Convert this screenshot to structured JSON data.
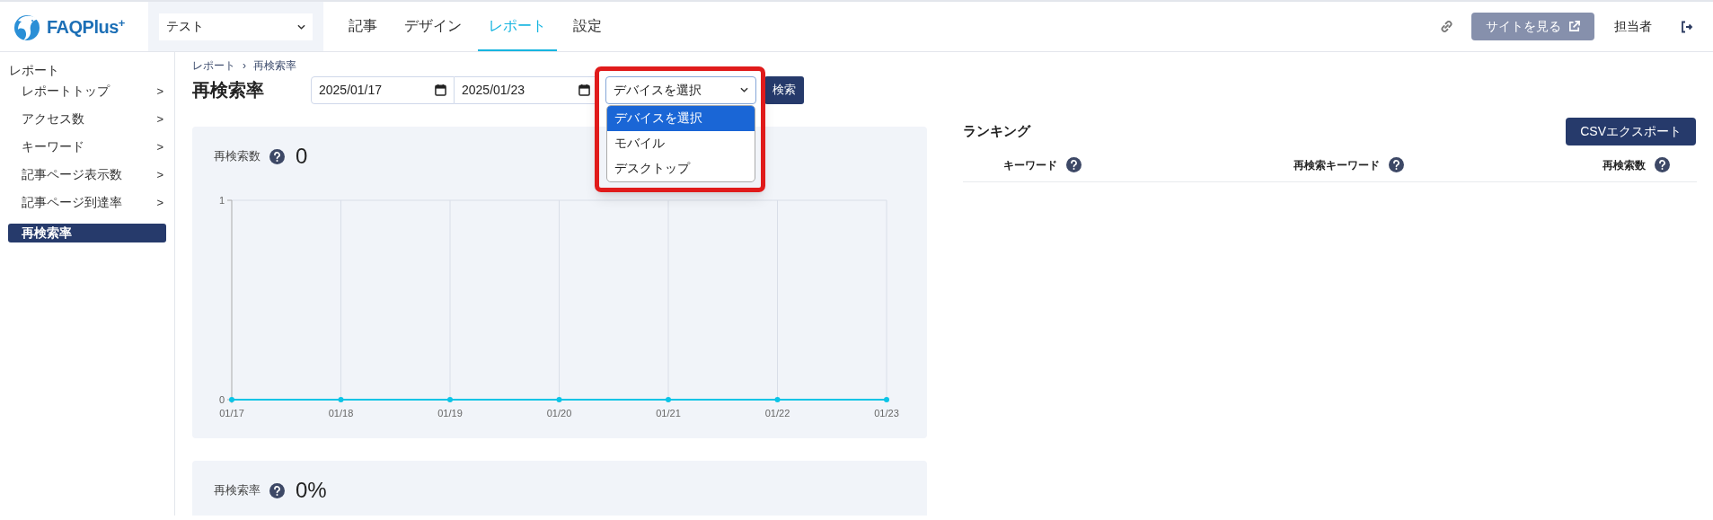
{
  "header": {
    "logo_text": "FAQPlus",
    "logo_sup": "+",
    "site_select": {
      "value": "テスト"
    },
    "nav": [
      {
        "label": "記事",
        "selected": false
      },
      {
        "label": "デザイン",
        "selected": false
      },
      {
        "label": "レポート",
        "selected": true
      },
      {
        "label": "設定",
        "selected": false
      }
    ],
    "view_site_button": "サイトを見る",
    "user": "担当者"
  },
  "sidebar": {
    "section": "レポート",
    "items": [
      {
        "label": "レポートトップ",
        "chevron": ">",
        "selected": false
      },
      {
        "label": "アクセス数",
        "chevron": ">",
        "selected": false
      },
      {
        "label": "キーワード",
        "chevron": ">",
        "selected": false
      },
      {
        "label": "記事ページ表示数",
        "chevron": ">",
        "selected": false
      },
      {
        "label": "記事ページ到達率",
        "chevron": ">",
        "selected": false
      },
      {
        "label": "再検索率",
        "selected": true
      }
    ]
  },
  "breadcrumb": [
    "レポート",
    "›",
    "再検索率"
  ],
  "title": "再検索率",
  "filters": {
    "start_date": "2025/01/17",
    "end_date": "2025/01/23",
    "device_select": {
      "value": "デバイスを選択",
      "expanded": true,
      "highlighted": true,
      "options": [
        {
          "label": "デバイスを選択",
          "selected": true
        },
        {
          "label": "モバイル",
          "selected": false
        },
        {
          "label": "デスクトップ",
          "selected": false
        }
      ]
    },
    "search_button": "検索"
  },
  "cards": [
    {
      "label": "再検索数",
      "value": "0",
      "chart_data": {
        "type": "line",
        "x": [
          "01/17",
          "01/18",
          "01/19",
          "01/20",
          "01/21",
          "01/22",
          "01/23"
        ],
        "series": [
          {
            "color": "#0bc4e6",
            "marker": true,
            "values": [
              0,
              0,
              0,
              0,
              0,
              0,
              0
            ]
          }
        ],
        "grid": true,
        "ylim": [
          0,
          1
        ],
        "yticks": [
          0,
          1
        ]
      }
    },
    {
      "label": "再検索率",
      "value": "0%"
    }
  ],
  "ranking": {
    "title": "ランキング",
    "export_button": "CSVエクスポート",
    "columns": [
      "キーワード",
      "再検索キーワード",
      "再検索数"
    ]
  }
}
